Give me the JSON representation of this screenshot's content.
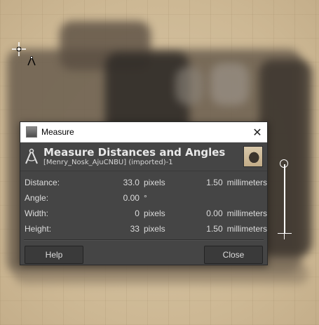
{
  "dialog": {
    "window_title": "Measure",
    "heading": "Measure Distances and Angles",
    "subheading": "[Menry_Nosk_AjuCNBU] (imported)-1",
    "rows": [
      {
        "label": "Distance:",
        "value": "33.0",
        "unit": "pixels",
        "value2": "1.50",
        "unit2": "millimeters"
      },
      {
        "label": "Angle:",
        "value": "0.00",
        "unit": "°",
        "value2": "",
        "unit2": ""
      },
      {
        "label": "Width:",
        "value": "0",
        "unit": "pixels",
        "value2": "0.00",
        "unit2": "millimeters"
      },
      {
        "label": "Height:",
        "value": "33",
        "unit": "pixels",
        "value2": "1.50",
        "unit2": "millimeters"
      }
    ],
    "help_label": "Help",
    "close_label": "Close"
  },
  "icons": {
    "window_icon": "gimp-window-icon",
    "close": "close-icon",
    "compass": "compass-icon",
    "cursor": "crosshair-cursor-icon"
  },
  "colors": {
    "dialog_bg": "#454545",
    "titlebar_bg": "#ffffff",
    "text": "#dcdcdc"
  }
}
